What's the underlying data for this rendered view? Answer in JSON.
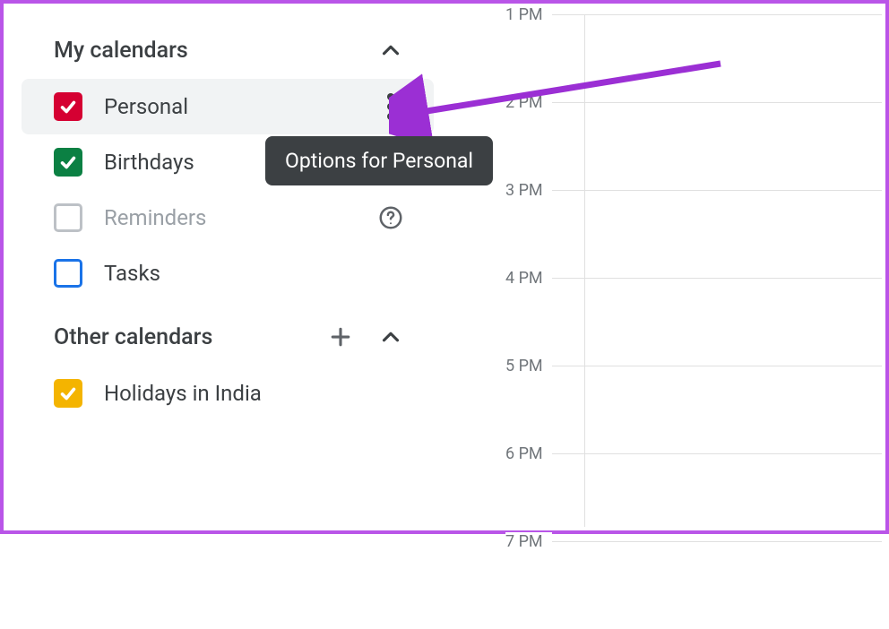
{
  "sidebar": {
    "section1": {
      "title": "My calendars"
    },
    "section2": {
      "title": "Other calendars"
    },
    "items": [
      {
        "label": "Personal",
        "color": "#d50032",
        "halo": "#f8d2da",
        "checked": true,
        "hovered": true,
        "showMore": true
      },
      {
        "label": "Birthdays",
        "color": "#0b8043",
        "checked": true
      },
      {
        "label": "Reminders",
        "color": "#bdc1c6",
        "checked": false,
        "disabled": true,
        "showHelp": true
      },
      {
        "label": "Tasks",
        "color": "#1a73e8",
        "checked": false
      }
    ],
    "otherItems": [
      {
        "label": "Holidays in India",
        "color": "#f4b400",
        "checked": true
      }
    ]
  },
  "tooltip": {
    "text": "Options for Personal"
  },
  "timegrid": {
    "hours": [
      "1 PM",
      "2 PM",
      "3 PM",
      "4 PM",
      "5 PM",
      "6 PM",
      "7 PM"
    ]
  }
}
